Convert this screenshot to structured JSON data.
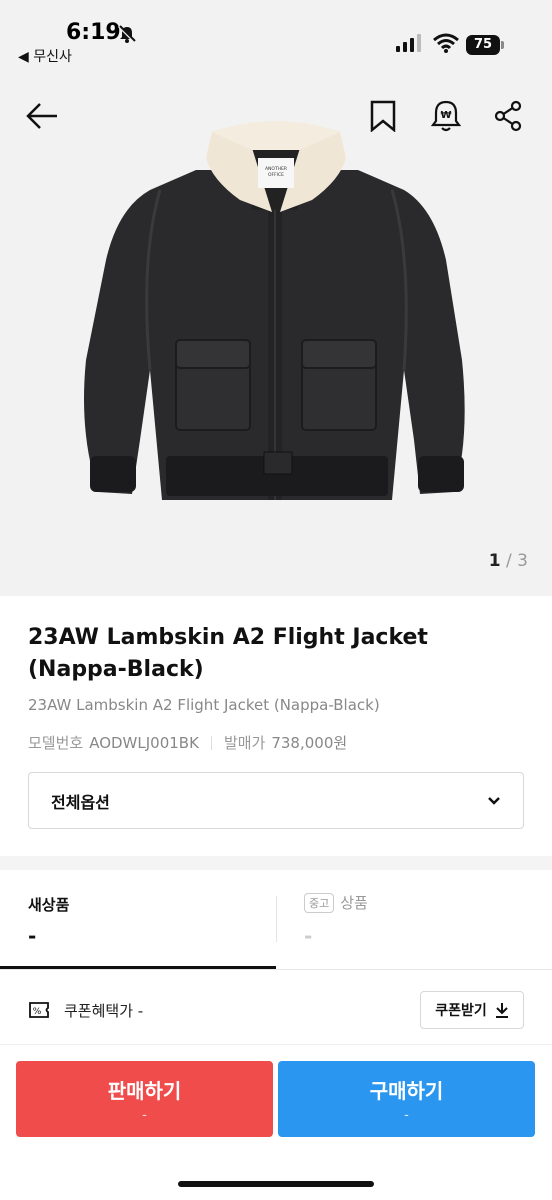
{
  "status_bar": {
    "time": "6:19",
    "back_app_label": "◀ 무신사",
    "battery": "75"
  },
  "product_image": {
    "brand_tag": "ANOTHER OFFICE",
    "counter_current": "1",
    "counter_total": "/ 3"
  },
  "product": {
    "title": "23AW Lambskin A2 Flight Jacket (Nappa-Black)",
    "subtitle": "23AW Lambskin A2 Flight Jacket (Nappa-Black)",
    "model_label": "모델번호",
    "model_value": "AODWLJ001BK",
    "release_price_label": "발매가",
    "release_price_value": "738,000원"
  },
  "option_select": {
    "label": "전체옵션"
  },
  "tabs": {
    "new_label": "새상품",
    "new_value": "-",
    "used_badge": "중고",
    "used_label": "상품",
    "used_value": "-"
  },
  "coupon": {
    "text": "쿠폰혜택가 -",
    "button_label": "쿠폰받기"
  },
  "actions": {
    "sell_label": "판매하기",
    "sell_sub": "-",
    "buy_label": "구매하기",
    "buy_sub": "-"
  },
  "colors": {
    "sell": "#f04c4c",
    "buy": "#2b96ef",
    "image_bg": "#f2f2f2"
  }
}
